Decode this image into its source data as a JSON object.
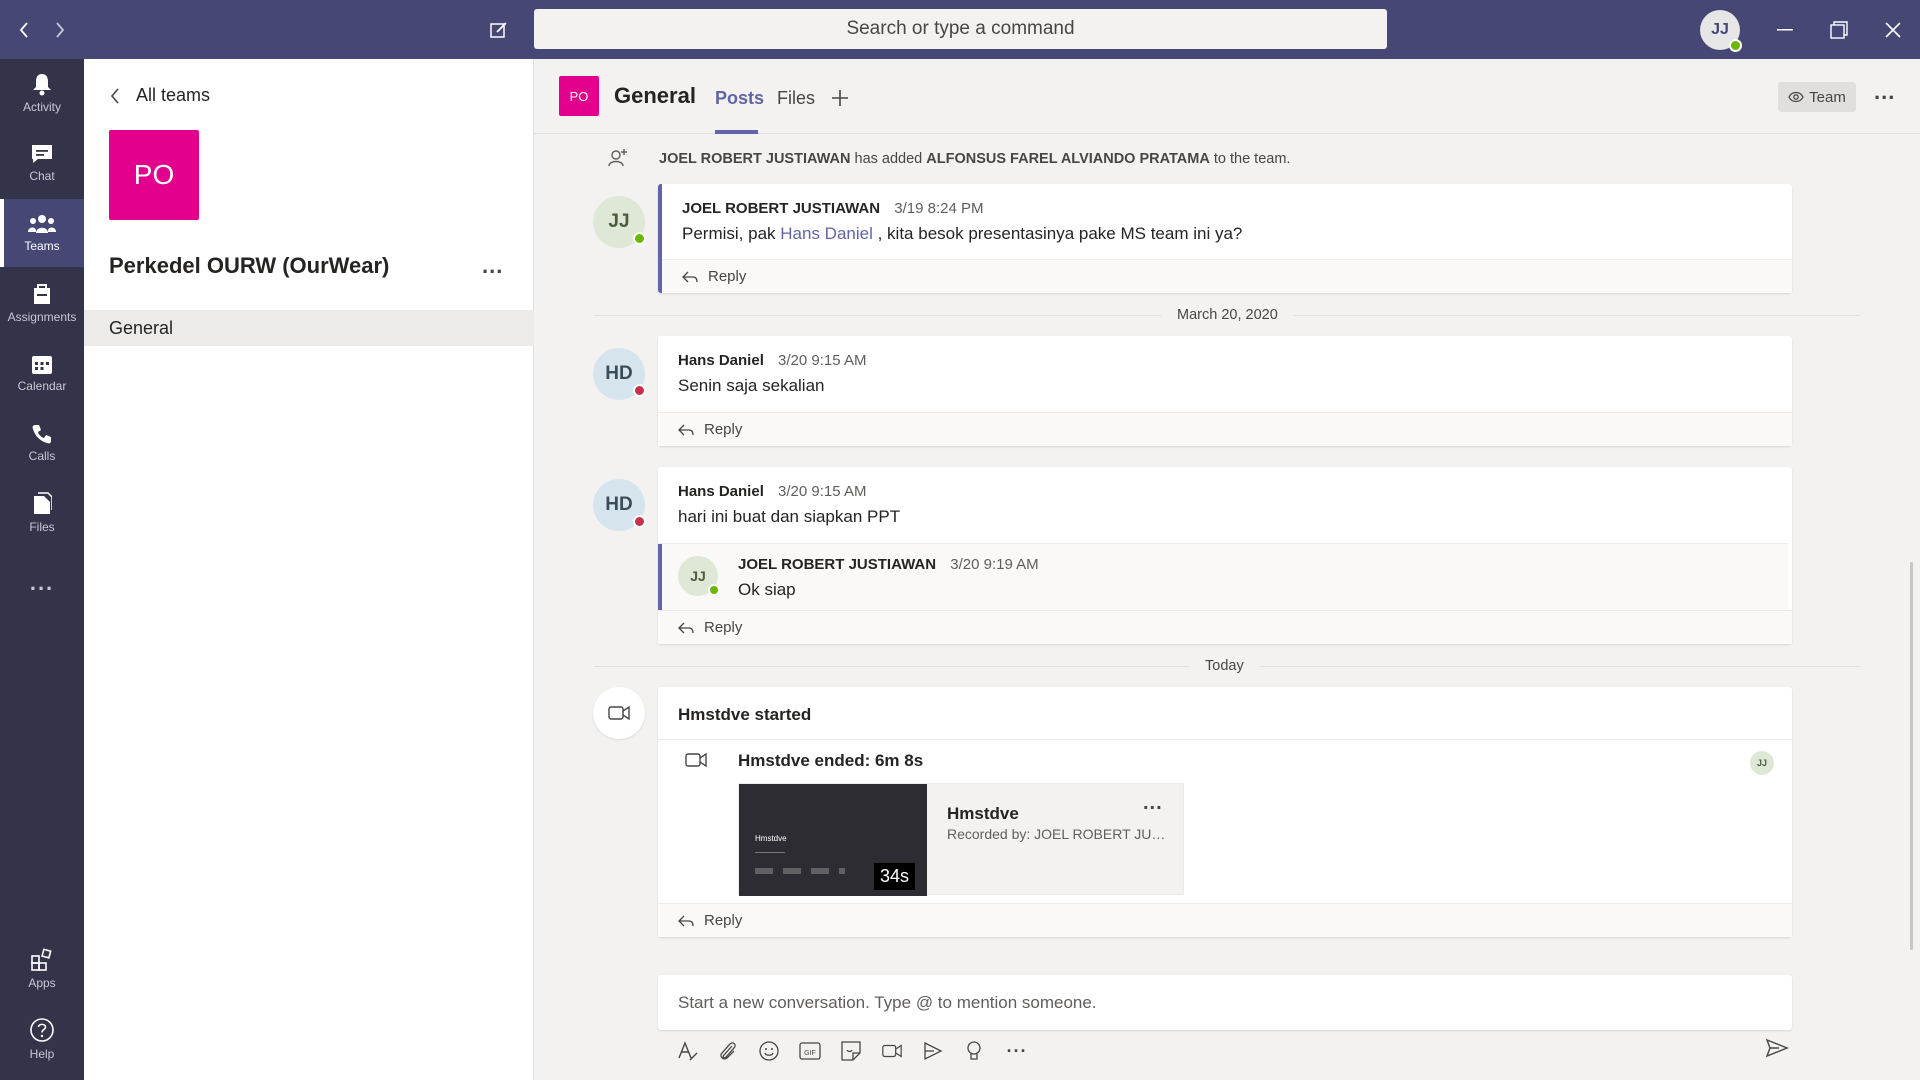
{
  "window": {
    "search_placeholder": "Search or type a command",
    "user_initials": "JJ"
  },
  "appbar": {
    "items": [
      {
        "label": "Activity",
        "icon": "bell-icon"
      },
      {
        "label": "Chat",
        "icon": "chat-icon"
      },
      {
        "label": "Teams",
        "icon": "teams-icon",
        "active": true
      },
      {
        "label": "Assignments",
        "icon": "assignments-icon"
      },
      {
        "label": "Calendar",
        "icon": "calendar-icon"
      },
      {
        "label": "Calls",
        "icon": "phone-icon"
      },
      {
        "label": "Files",
        "icon": "files-icon"
      }
    ],
    "more": "...",
    "apps_label": "Apps",
    "help_label": "Help"
  },
  "team_panel": {
    "back_label": "All teams",
    "team_initials": "PO",
    "team_name": "Perkedel OURW (OurWear)",
    "more": "...",
    "channels": [
      "General"
    ]
  },
  "channel_header": {
    "initials": "PO",
    "name": "General",
    "tabs": [
      "Posts",
      "Files"
    ],
    "active_tab": "Posts",
    "team_button": "Team",
    "more": "..."
  },
  "feed": {
    "system_message": {
      "actor": "JOEL ROBERT JUSTIAWAN",
      "verb": "has added",
      "target": "ALFONSUS FAREL ALVIANDO PRATAMA",
      "suffix": "to the team."
    },
    "msg1": {
      "initials": "JJ",
      "author": "JOEL ROBERT JUSTIAWAN",
      "time": "3/19 8:24 PM",
      "text_before": "Permisi, pak",
      "mention": "Hans Daniel",
      "text_after": ", kita besok presentasinya pake MS team ini ya?",
      "reply": "Reply"
    },
    "date_divider_1": "March 20, 2020",
    "msg2": {
      "initials": "HD",
      "author": "Hans Daniel",
      "time": "3/20 9:15 AM",
      "text": "Senin saja sekalian",
      "reply": "Reply"
    },
    "msg3": {
      "initials": "HD",
      "author": "Hans Daniel",
      "time": "3/20 9:15 AM",
      "text": "hari ini buat dan siapkan PPT",
      "nested": {
        "initials": "JJ",
        "author": "JOEL ROBERT JUSTIAWAN",
        "time": "3/20 9:19 AM",
        "text": "Ok siap"
      },
      "reply": "Reply"
    },
    "date_divider_2": "Today",
    "meeting": {
      "started": "Hmstdve started",
      "ended": "Hmstdve ended: 6m 8s",
      "participant_initials": "JJ",
      "recording": {
        "title": "Hmstdve",
        "recorded_by": "Recorded by: JOEL ROBERT JUS...",
        "duration": "34s",
        "thumb_title": "Hmstdve",
        "more": "..."
      },
      "reply": "Reply"
    }
  },
  "compose": {
    "placeholder": "Start a new conversation. Type @ to mention someone."
  },
  "colors": {
    "titlebar": "#464775",
    "appbar": "#33344a",
    "accent": "#6264a7",
    "team_tile": "#e3008c"
  }
}
